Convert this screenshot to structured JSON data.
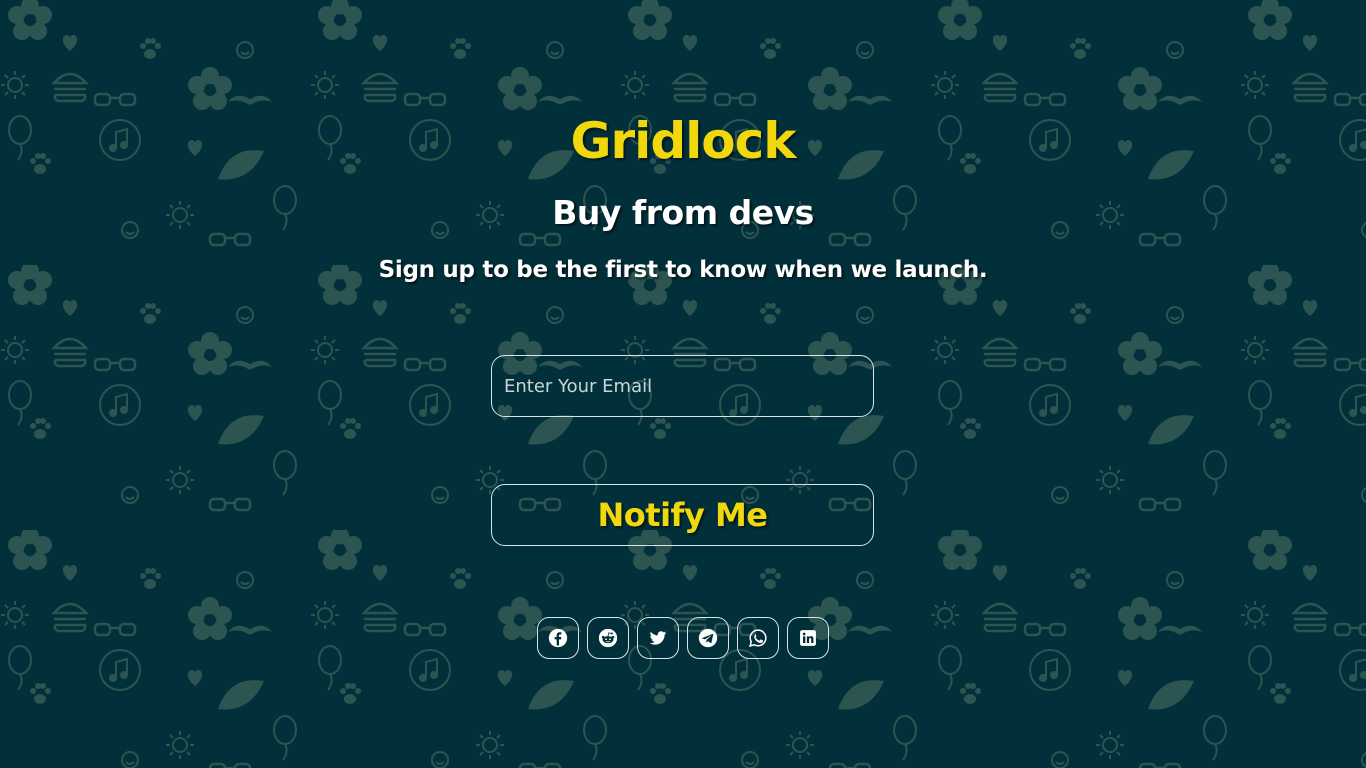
{
  "brand": {
    "title": "Gridlock",
    "subtitle": "Buy from devs",
    "tagline": "Sign up to be the first to know when we launch."
  },
  "form": {
    "email_placeholder": "Enter Your Email",
    "email_value": "",
    "submit_label": "Notify Me"
  },
  "social": [
    {
      "name": "facebook-icon"
    },
    {
      "name": "reddit-icon"
    },
    {
      "name": "twitter-icon"
    },
    {
      "name": "telegram-icon"
    },
    {
      "name": "whatsapp-icon"
    },
    {
      "name": "linkedin-icon"
    }
  ],
  "colors": {
    "background": "#02303a",
    "accent": "#f0d80c",
    "text": "#ffffff",
    "border": "#d8e4e6",
    "pattern": "#2f5754"
  }
}
